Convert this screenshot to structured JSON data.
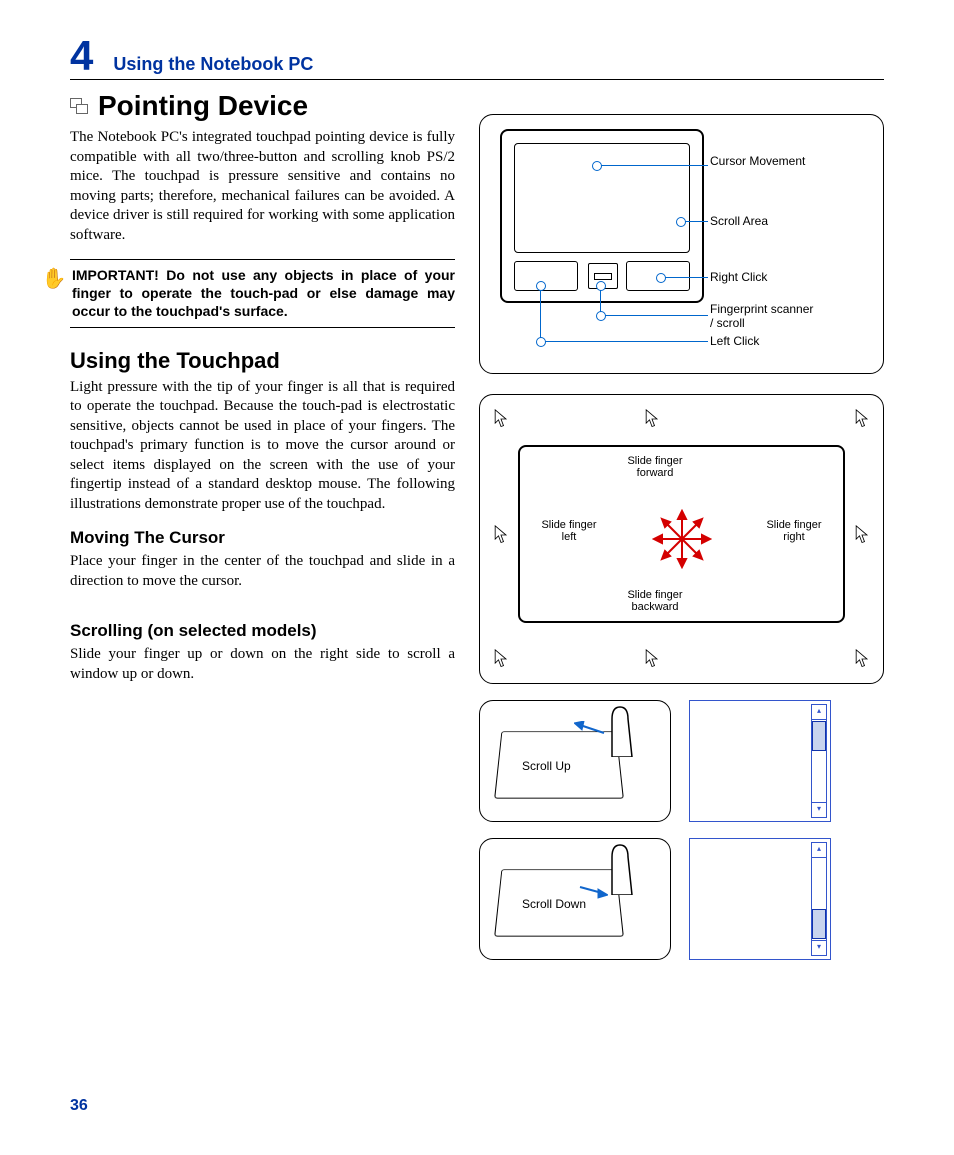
{
  "chapter": {
    "number": "4",
    "title": "Using the Notebook PC"
  },
  "section": {
    "title": "Pointing Device",
    "intro": "The Notebook PC's integrated touchpad pointing device is fully compatible with all two/three-button and scrolling knob PS/2 mice. The touchpad is pressure sensitive and contains no moving parts; therefore, mechanical failures can be avoided. A device driver is still required for working with some application software.",
    "important": "IMPORTANT! Do not use any objects in place of your finger to operate the touch-pad or else damage may occur to the touchpad's surface."
  },
  "touchpad": {
    "heading": "Using the Touchpad",
    "body": "Light pressure with the tip of your finger is all that is required to operate the touchpad. Because the touch-pad is electrostatic sensitive, objects cannot be used in place of your fingers. The touchpad's primary function is to move the cursor around or select items displayed on the screen with the use of your fingertip instead of a standard desktop mouse. The following illustrations demonstrate proper use of the touchpad.",
    "moving_h": "Moving The Cursor",
    "moving_b": "Place your finger in the center of the touchpad and slide in a direction to move the cursor.",
    "scrolling_h": "Scrolling (on selected models)",
    "scrolling_b": "Slide your finger up or down on the right side to scroll a window up or down."
  },
  "diagram1": {
    "cursor_movement": "Cursor Movement",
    "scroll_area": "Scroll Area",
    "right_click": "Right Click",
    "fingerprint": "Fingerprint scanner / scroll",
    "left_click": "Left Click"
  },
  "diagram2": {
    "forward": "Slide finger forward",
    "backward": "Slide finger backward",
    "left": "Slide finger left",
    "right": "Slide finger right"
  },
  "diagram3": {
    "scroll_up": "Scroll Up",
    "scroll_down": "Scroll Down"
  },
  "page_number": "36"
}
